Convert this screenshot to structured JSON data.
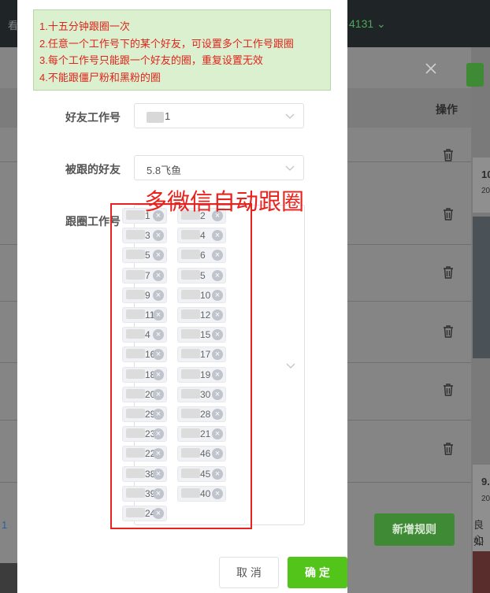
{
  "background": {
    "top_left_text": "看",
    "account_suffix": "4131",
    "table_header_action": "操作",
    "add_rule_button": "新增规则",
    "right_card_1_title": "10",
    "right_card_1_sub": "20",
    "right_card_2_title": "9.",
    "right_card_2_sub": "20",
    "right_card_text_1": "良心",
    "right_card_text_2": "如一",
    "left_number": "1"
  },
  "notice": {
    "lines": [
      "1.十五分钟跟圈一次",
      "2.任意一个工作号下的某个好友，可设置多个工作号跟圈",
      "3.每个工作号只能跟一个好友的圈，重复设置无效",
      "4.不能跟僵尸粉和黑粉的圈"
    ]
  },
  "form": {
    "friend_account_label": "好友工作号",
    "friend_account_value_suffix": "1",
    "followed_friend_label": "被跟的好友",
    "followed_friend_value": "5.8飞鱼",
    "follow_accounts_label": "跟圈工作号",
    "tags": [
      {
        "text": "1"
      },
      {
        "text": "2"
      },
      {
        "text": "3"
      },
      {
        "text": "4"
      },
      {
        "text": "5"
      },
      {
        "text": "6"
      },
      {
        "text": "7"
      },
      {
        "text": "5"
      },
      {
        "text": "9"
      },
      {
        "text": "10"
      },
      {
        "text": "11"
      },
      {
        "text": "12"
      },
      {
        "text": "4"
      },
      {
        "text": "15"
      },
      {
        "text": "16"
      },
      {
        "text": "17"
      },
      {
        "text": "18"
      },
      {
        "text": "19"
      },
      {
        "text": "20"
      },
      {
        "text": "30"
      },
      {
        "text": "29"
      },
      {
        "text": "28"
      },
      {
        "text": "23"
      },
      {
        "text": "21"
      },
      {
        "text": "22"
      },
      {
        "text": "46"
      },
      {
        "text": "38"
      },
      {
        "text": "45"
      },
      {
        "text": "39"
      },
      {
        "text": "40"
      },
      {
        "text": "24"
      }
    ]
  },
  "annotation": {
    "text": "多微信自动跟圈",
    "color": "#e8231d"
  },
  "buttons": {
    "cancel": "取 消",
    "confirm": "确 定"
  },
  "colors": {
    "primary_green": "#52c41a",
    "notice_bg": "#daf0cf",
    "notice_text": "#e0231b"
  }
}
